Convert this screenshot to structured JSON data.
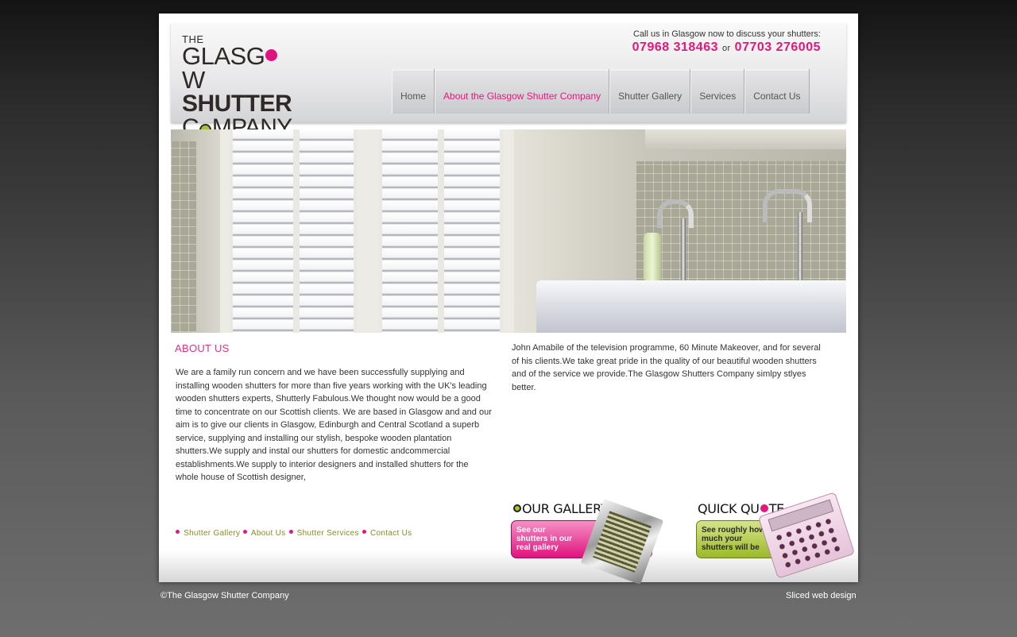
{
  "logo": {
    "line1": "THE",
    "line2_a": "GLASG",
    "line2_b": "W",
    "line3": "SHUTTER",
    "line4_a": "C",
    "line4_b": "MPANY"
  },
  "contact": {
    "call_text": "Call us in Glasgow now to discuss your shutters:",
    "phone1": "07968 318463",
    "or": "or",
    "phone2": "07703 276005"
  },
  "nav": {
    "items": [
      {
        "label": "Home"
      },
      {
        "label": "About the Glasgow Shutter Company"
      },
      {
        "label": "Shutter Gallery"
      },
      {
        "label": "Services"
      },
      {
        "label": "Contact Us"
      }
    ],
    "active_color": "#e2187f"
  },
  "about": {
    "title": "ABOUT US",
    "left_text": "We are a family run concern and we have been successfully supplying and installing wooden shutters for more than five years working with the UK's leading wooden shutters experts, Shutterly Fabulous.We thought now would be a good time to concentrate on our Scottish clients. We are based in Glasgow and and our aim is to give our clients in Glasgow, Edinburgh and Central Scotland a superb service, supplying and installing our stylish, bespoke wooden plantation shutters.We supply and instal our shutters for domestic andcommercial establishments.We supply to interior designers and installed shutters for the whole house of Scottish designer,",
    "right_text": "John Amabile of the television programme, 60 Minute Makeover, and for several of his clients.We take great pride in the quality of our beautiful wooden shutters and of the service we provide.The Glasgow Shutters Company simlpy stlyes better."
  },
  "footer_links": [
    {
      "label": "Shutter Gallery"
    },
    {
      "label": "About Us"
    },
    {
      "label": "Shutter Services"
    },
    {
      "label": "Contact Us"
    }
  ],
  "promos": {
    "gallery": {
      "title_a": "OUR GALLERY",
      "line1": "See our",
      "line2": "shutters in our",
      "line3": "real gallery"
    },
    "quote": {
      "title_a": "QUICK QU",
      "title_b": "TE",
      "line1": "See roughly how",
      "line2": "much your",
      "line3": "shutters will be"
    }
  },
  "footer": {
    "copyright": "©The Glasgow Shutter Company",
    "credit": "Sliced web design"
  },
  "colors": {
    "brand_pink": "#e2187f",
    "brand_green": "#a7c52b",
    "title_pink": "#d6348c"
  }
}
